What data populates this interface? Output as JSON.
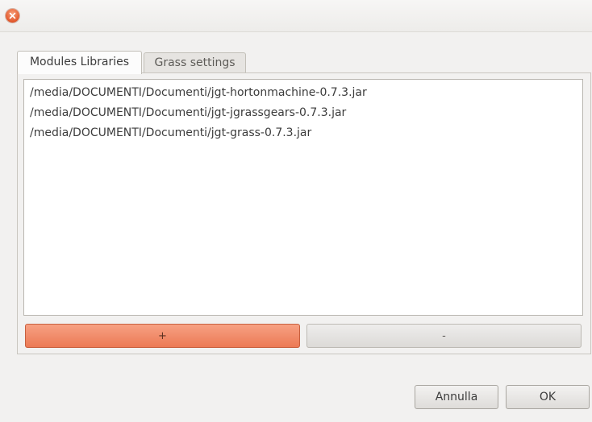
{
  "window": {
    "close_icon": "close-icon",
    "accent": "#e2582c"
  },
  "tabs": [
    {
      "label": "Modules Libraries",
      "active": true
    },
    {
      "label": "Grass settings",
      "active": false
    }
  ],
  "libraries": [
    "/media/DOCUMENTI/Documenti/jgt-hortonmachine-0.7.3.jar",
    "/media/DOCUMENTI/Documenti/jgt-jgrassgears-0.7.3.jar",
    "/media/DOCUMENTI/Documenti/jgt-grass-0.7.3.jar"
  ],
  "list_buttons": {
    "add_label": "+",
    "remove_label": "-"
  },
  "dialog_buttons": {
    "cancel_label": "Annulla",
    "ok_label": "OK"
  }
}
